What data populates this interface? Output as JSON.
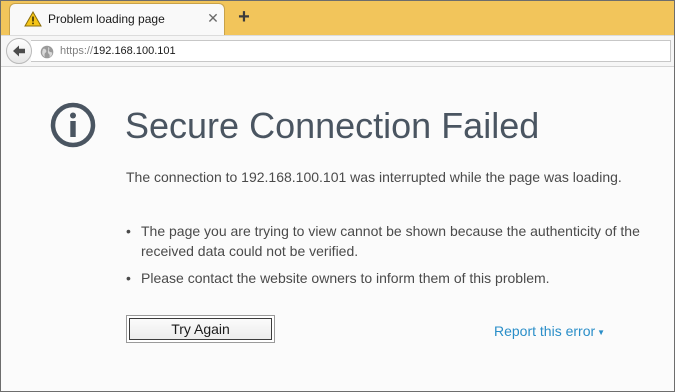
{
  "tab": {
    "title": "Problem loading page",
    "icon": "warning-icon",
    "close_glyph": "✕"
  },
  "new_tab_glyph": "+",
  "navbar": {
    "back_icon": "back-arrow-icon",
    "url_scheme": "https://",
    "url_host": "192.168.100.101"
  },
  "error": {
    "title": "Secure Connection Failed",
    "description": "The connection to 192.168.100.101 was interrupted while the page was loading.",
    "bullets": [
      "The page you are trying to view cannot be shown because the authenticity of the received data could not be verified.",
      "Please contact the website owners to inform them of this problem."
    ],
    "bullet_glyph": "•",
    "try_again_label": "Try Again",
    "report_label": "Report this error",
    "report_arrow": "▼"
  },
  "colors": {
    "tabstrip": "#f2c55b",
    "title_text": "#4a5561",
    "link": "#2a8ec8"
  }
}
